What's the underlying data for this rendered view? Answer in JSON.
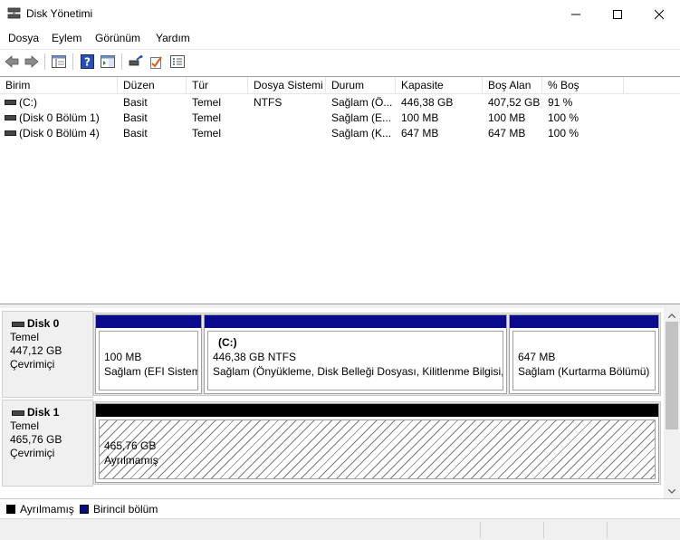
{
  "window": {
    "title": "Disk Yönetimi"
  },
  "menu": [
    "Dosya",
    "Eylem",
    "Görünüm",
    "Yardım"
  ],
  "columns": [
    "Birim",
    "Düzen",
    "Tür",
    "Dosya Sistemi",
    "Durum",
    "Kapasite",
    "Boş Alan",
    "% Boş"
  ],
  "volumes": [
    {
      "birim": " (C:)",
      "duzen": "Basit",
      "tur": "Temel",
      "dosya_sistemi": "NTFS",
      "durum": "Sağlam (Ö...",
      "kapasite": "446,38 GB",
      "bos_alan": "407,52 GB",
      "bos_yuzde": "91 %"
    },
    {
      "birim": "(Disk 0 Bölüm 1)",
      "duzen": "Basit",
      "tur": "Temel",
      "dosya_sistemi": "",
      "durum": "Sağlam (E...",
      "kapasite": "100 MB",
      "bos_alan": "100 MB",
      "bos_yuzde": "100 %"
    },
    {
      "birim": "(Disk 0 Bölüm 4)",
      "duzen": "Basit",
      "tur": "Temel",
      "dosya_sistemi": "",
      "durum": "Sağlam (K...",
      "kapasite": "647 MB",
      "bos_alan": "647 MB",
      "bos_yuzde": "100 %"
    }
  ],
  "disks": [
    {
      "name": "Disk 0",
      "type": "Temel",
      "size": "447,12 GB",
      "state": "Çevrimiçi",
      "partitions": [
        {
          "title": "",
          "size": "100 MB",
          "status": "Sağlam (EFI Sistem"
        },
        {
          "title": "(C:)",
          "size": "446,38 GB NTFS",
          "status": "Sağlam (Önyükleme, Disk Belleği Dosyası, Kilitlenme Bilgisi, T"
        },
        {
          "title": "",
          "size": "647 MB",
          "status": "Sağlam (Kurtarma Bölümü)"
        }
      ]
    },
    {
      "name": "Disk 1",
      "type": "Temel",
      "size": "465,76 GB",
      "state": "Çevrimiçi",
      "partitions": [
        {
          "size": "465,76 GB",
          "status": "Ayrılmamış"
        }
      ]
    }
  ],
  "legend": [
    {
      "label": "Ayrılmamış",
      "color": "#000000"
    },
    {
      "label": "Birincil bölüm",
      "color": "#0a0a8c"
    }
  ],
  "colors": {
    "primary_partition": "#0a0a8c",
    "unallocated": "#000000",
    "checkmark": "#e05a1e"
  }
}
